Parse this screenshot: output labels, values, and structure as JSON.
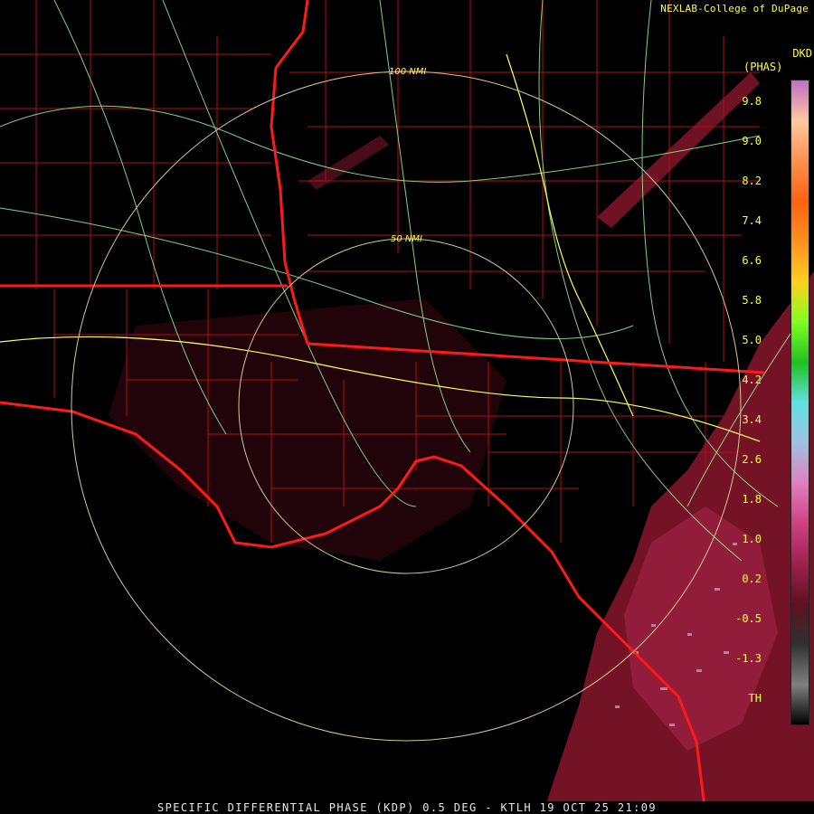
{
  "header": {
    "credit": "NEXLAB-College of DuPage",
    "unit_line1": "DKD",
    "unit_line2": "(PHAS)"
  },
  "range_rings": [
    {
      "label": "50 NMI"
    },
    {
      "label": "100 NMI"
    }
  ],
  "colorbar": {
    "ticks": [
      "9.8",
      "9.0",
      "8.2",
      "7.4",
      "6.6",
      "5.8",
      "5.0",
      "4.2",
      "3.4",
      "2.6",
      "1.8",
      "1.0",
      "0.2",
      "-0.5",
      "-1.3",
      "TH"
    ],
    "colors": [
      "#c070c0",
      "#ffc8a0",
      "#ff9050",
      "#ff6010",
      "#ff9020",
      "#ffd020",
      "#80ff20",
      "#20c020",
      "#60e0e0",
      "#a0c0e0",
      "#e080c0",
      "#d04080",
      "#a02050",
      "#601020",
      "#303030",
      "#808080",
      "#000000"
    ]
  },
  "colors": {
    "state_border": "#ff1a1a",
    "county_border": "#c01010",
    "highway": "#90e890",
    "interstate": "#ffff60",
    "range_ring": "#d8c890",
    "echo": "#8b1a2c"
  },
  "footer": {
    "caption": "SPECIFIC DIFFERENTIAL PHASE (KDP) 0.5 DEG - KTLH 19 OCT 25 21:09"
  }
}
